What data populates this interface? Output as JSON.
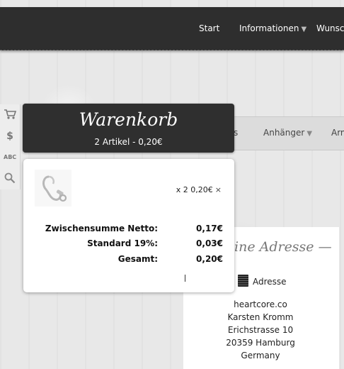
{
  "topnav": {
    "items": [
      {
        "label": "Start",
        "has_dropdown": false
      },
      {
        "label": "Informationen",
        "has_dropdown": true
      },
      {
        "label": "Wunsch",
        "has_dropdown": false
      }
    ]
  },
  "sidebar_icons": [
    "cart-icon",
    "dollar-icon",
    "abc-icon",
    "search-icon"
  ],
  "sidebar_text": {
    "abc": "ABC",
    "dollar": "$"
  },
  "catnav": {
    "items": [
      {
        "label": "s",
        "has_dropdown": false
      },
      {
        "label": "Anhänger",
        "has_dropdown": true
      },
      {
        "label": "Arm",
        "has_dropdown": false
      }
    ]
  },
  "cart": {
    "title": "Warenkorb",
    "summary": "2 Artikel - 0,20€",
    "item": {
      "quantity_price": "x 2 0,20€",
      "remove": "×"
    },
    "totals": [
      {
        "label": "Zwischensumme Netto:",
        "value": "0,17€"
      },
      {
        "label": "Standard 19%:",
        "value": "0,03€"
      },
      {
        "label": "Gesamt:",
        "value": "0,20€"
      }
    ]
  },
  "address": {
    "title": "ine Adresse",
    "title_deco": "—",
    "label": "Adresse",
    "lines": [
      "heartcore.co",
      "Karsten Kromm",
      "Erichstrasse 10",
      "20359 Hamburg",
      "Germany"
    ]
  },
  "colors": {
    "topbar": "#2e2e2e",
    "cart_header": "#2f2f2f",
    "panel": "#ffffff",
    "background": "#e8e8e8"
  }
}
